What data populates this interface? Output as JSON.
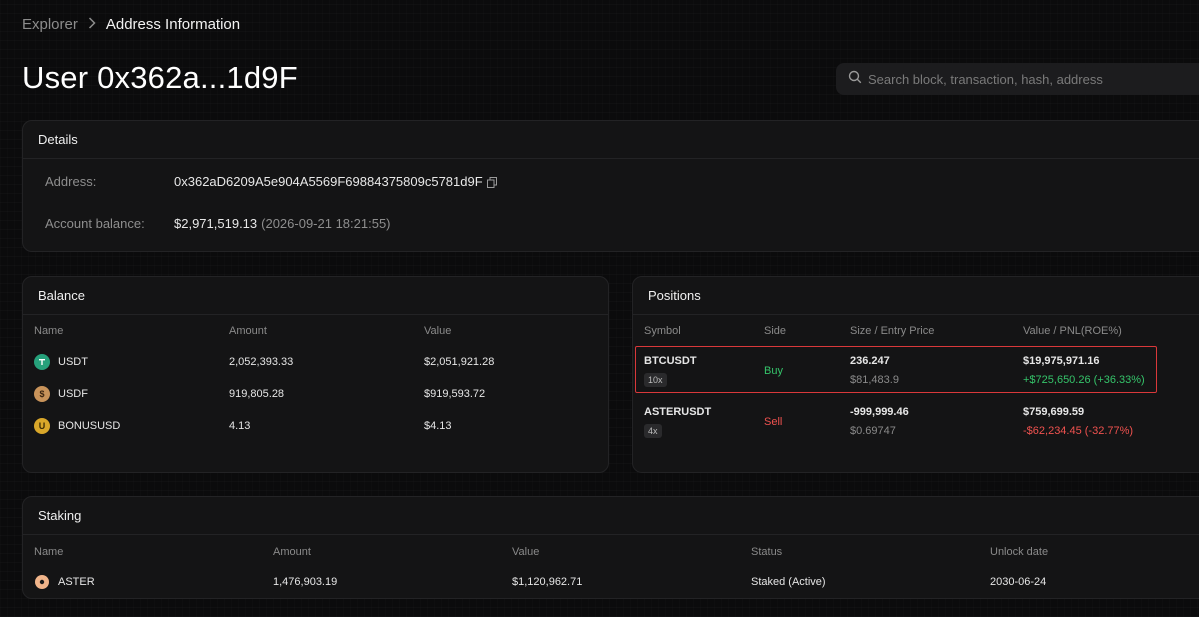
{
  "breadcrumb": {
    "root": "Explorer",
    "separator": ">",
    "current": "Address Information"
  },
  "page": {
    "title": "User 0x362a...1d9F"
  },
  "search": {
    "placeholder": "Search block, transaction, hash, address"
  },
  "details": {
    "header": "Details",
    "address_label": "Address:",
    "address_value": "0x362aD6209A5e904A5569F69884375809c5781d9F",
    "balance_label": "Account balance:",
    "balance_value": "$2,971,519.13",
    "balance_time": "(2026-09-21 18:21:55)"
  },
  "balance": {
    "header": "Balance",
    "columns": [
      "Name",
      "Amount",
      "Value"
    ],
    "rows": [
      {
        "name": "USDT",
        "amount": "2,052,393.33",
        "value": "$2,051,921.28",
        "icon": "tether-icon",
        "color": "#26a17b"
      },
      {
        "name": "USDF",
        "amount": "919,805.28",
        "value": "$919,593.72",
        "icon": "usdf-icon",
        "color": "#c8935a"
      },
      {
        "name": "BONUSUSD",
        "amount": "4.13",
        "value": "$4.13",
        "icon": "bonususd-icon",
        "color": "#d9a72a"
      }
    ]
  },
  "positions": {
    "header": "Positions",
    "columns": [
      "Symbol",
      "Side",
      "Size / Entry Price",
      "Value / PNL(ROE%)"
    ],
    "rows": [
      {
        "symbol": "BTCUSDT",
        "leverage": "10x",
        "side": "Buy",
        "size": "236.247",
        "entry": "$81,483.9",
        "value": "$19,975,971.16",
        "pnl": "+$725,650.26 (+36.33%)"
      },
      {
        "symbol": "ASTERUSDT",
        "leverage": "4x",
        "side": "Sell",
        "size": "-999,999.46",
        "entry": "$0.69747",
        "value": "$759,699.59",
        "pnl": "-$62,234.45 (-32.77%)"
      }
    ]
  },
  "staking": {
    "header": "Staking",
    "columns": [
      "Name",
      "Amount",
      "Value",
      "Status",
      "Unlock date"
    ],
    "rows": [
      {
        "name": "ASTER",
        "amount": "1,476,903.19",
        "value": "$1,120,962.71",
        "status": "Staked (Active)",
        "unlock": "2030-06-24",
        "icon": "aster-icon"
      }
    ]
  },
  "colors": {
    "buy": "#35c46a",
    "sell": "#f0524f",
    "highlight": "#d9383a"
  }
}
